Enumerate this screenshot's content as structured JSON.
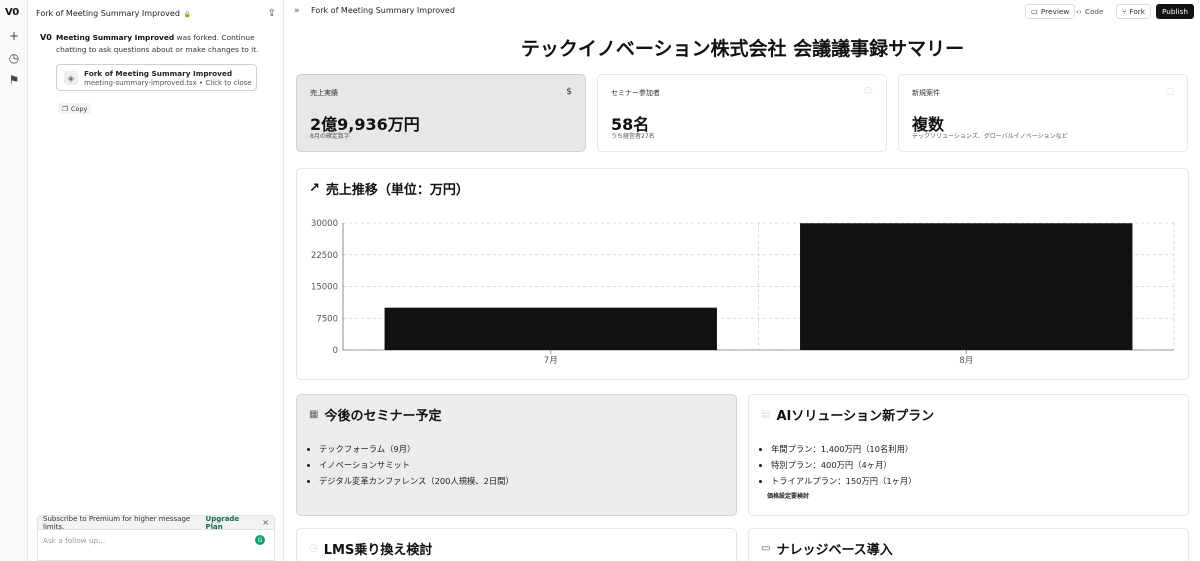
{
  "rail": {
    "logo": "V0"
  },
  "chat": {
    "header_title": "Fork of Meeting Summary Improved",
    "message_logo": "V0",
    "message_bold": "Meeting Summary Improved",
    "message_rest": " was forked. Continue chatting to ask questions about or make changes to it.",
    "fork_card": {
      "title": "Fork of Meeting Summary Improved",
      "file": "meeting-summary-improved.tsx",
      "action": " • Click to close"
    },
    "copy_label": "Copy",
    "upgrade_text": "Subscribe to Premium for higher message limits.",
    "upgrade_plan": "Upgrade Plan",
    "followup_placeholder": "Ask a follow up..."
  },
  "topbar": {
    "title": "Fork of Meeting Summary Improved",
    "preview": "Preview",
    "code": "Code",
    "fork": "Fork",
    "publish": "Publish"
  },
  "page": {
    "title": "テックイノベーション株式会社 会議議事録サマリー",
    "stats": [
      {
        "label": "売上実績",
        "icon": "$",
        "value": "2億9,936万円",
        "sub": "8月の確定数字"
      },
      {
        "label": "セミナー参加者",
        "icon": "☺",
        "value": "58名",
        "sub": "うち経営者27名"
      },
      {
        "label": "新規案件",
        "icon": "▢",
        "value": "複数",
        "sub": "テックソリューションズ、グローバルイノベーションなど"
      }
    ],
    "chart_heading": "売上推移（単位：万円）",
    "seminar": {
      "heading": "今後のセミナー予定",
      "items": [
        "テックフォーラム（9月）",
        "イノベーションサミット",
        "デジタル変革カンファレンス（200人規模、2日間）"
      ]
    },
    "ai": {
      "heading": "AIソリューション新プラン",
      "items": [
        "年間プラン：1,400万円（10名利用）",
        "特別プラン：400万円（4ヶ月）",
        "トライアルプラン：150万円（1ヶ月）"
      ],
      "note": "価格設定要検討"
    },
    "lms": {
      "heading": "LMS乗り換え検討"
    },
    "kb": {
      "heading": "ナレッジベース導入"
    }
  },
  "chart_data": {
    "type": "bar",
    "title": "売上推移（単位：万円）",
    "categories": [
      "7月",
      "8月"
    ],
    "values": [
      10000,
      29936
    ],
    "yticks": [
      0,
      7500,
      15000,
      22500,
      30000
    ],
    "ylim": [
      0,
      30000
    ],
    "grid": true,
    "color": "#111111"
  }
}
